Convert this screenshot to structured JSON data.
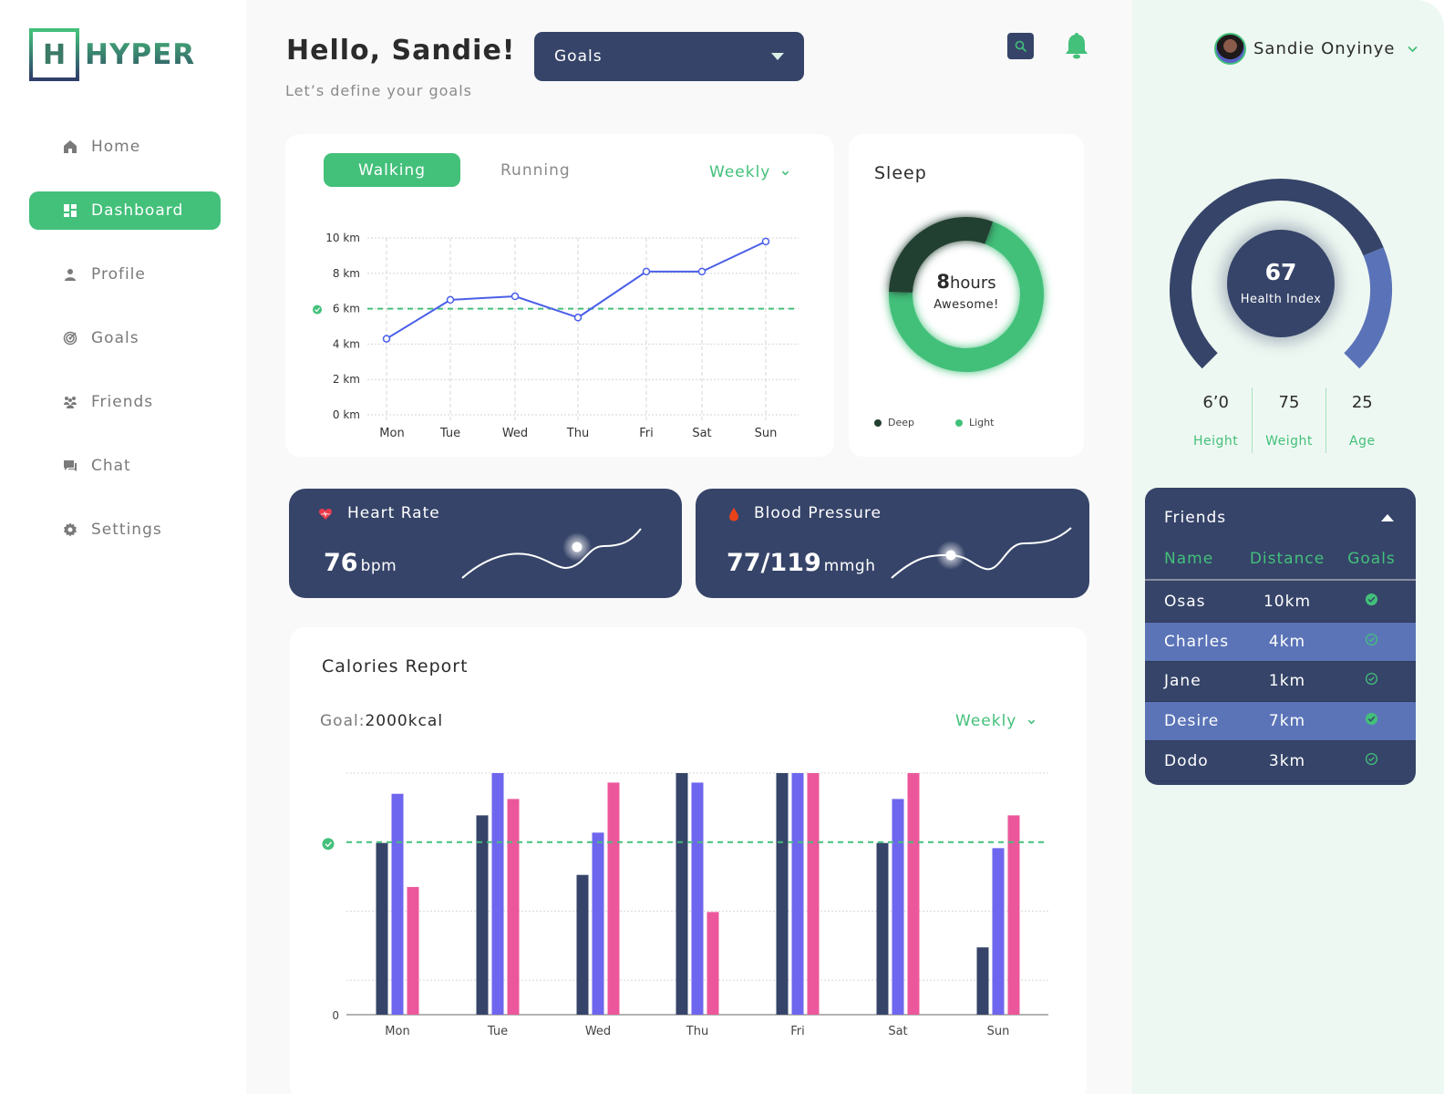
{
  "app": {
    "logo_letter": "H",
    "logo_text": "HYPER"
  },
  "sidebar": {
    "items": [
      {
        "label": "Home",
        "icon": "home-icon",
        "active": false
      },
      {
        "label": "Dashboard",
        "icon": "dashboard-icon",
        "active": true
      },
      {
        "label": "Profile",
        "icon": "user-icon",
        "active": false
      },
      {
        "label": "Goals",
        "icon": "target-icon",
        "active": false
      },
      {
        "label": "Friends",
        "icon": "group-icon",
        "active": false
      },
      {
        "label": "Chat",
        "icon": "chat-icon",
        "active": false
      },
      {
        "label": "Settings",
        "icon": "gear-icon",
        "active": false
      }
    ]
  },
  "header": {
    "greeting": "Hello, Sandie!",
    "subtitle": "Let’s define your goals",
    "select_value": "Goals",
    "search_icon": "search-icon",
    "bell_icon": "bell-icon"
  },
  "profile": {
    "name": "Sandie Onyinye"
  },
  "activity": {
    "tabs": [
      "Walking",
      "Running"
    ],
    "active_tab": "Walking",
    "period": "Weekly"
  },
  "sleep": {
    "title": "Sleep",
    "hours": "8",
    "hours_unit": "hours",
    "status": "Awesome!",
    "legend": [
      "Deep",
      "Light"
    ]
  },
  "heart_rate": {
    "title": "Heart Rate",
    "value": "76",
    "unit": "bpm"
  },
  "blood_pressure": {
    "title": "Blood Pressure",
    "value": "77/119",
    "unit": "mmgh"
  },
  "calories": {
    "title": "Calories Report",
    "goal_label": "Goal:",
    "goal_value": "2000kcal",
    "period": "Weekly"
  },
  "health": {
    "index": "67",
    "index_label": "Health Index",
    "stats": [
      {
        "value": "6’0",
        "label": "Height"
      },
      {
        "value": "75",
        "label": "Weight"
      },
      {
        "value": "25",
        "label": "Age"
      }
    ]
  },
  "friends": {
    "title": "Friends",
    "columns": [
      "Name",
      "Distance",
      "Goals"
    ],
    "rows": [
      {
        "name": "Osas",
        "distance": "10km",
        "goal_met": true
      },
      {
        "name": "Charles",
        "distance": "4km",
        "goal_met": false
      },
      {
        "name": "Jane",
        "distance": "1km",
        "goal_met": false
      },
      {
        "name": "Desire",
        "distance": "7km",
        "goal_met": true
      },
      {
        "name": "Dodo",
        "distance": "3km",
        "goal_met": false
      }
    ]
  },
  "colors": {
    "accent": "#43c07a",
    "navy": "#364469",
    "line": "#4a5ee8",
    "bar1": "#364469",
    "bar2": "#6e66ee",
    "bar3": "#ec579b",
    "deep_sleep": "#233f30",
    "gauge_light": "#5a73b8"
  },
  "chart_data": [
    {
      "type": "line",
      "title": "Walking",
      "categories": [
        "Mon",
        "Tue",
        "Wed",
        "Thu",
        "Fri",
        "Sat",
        "Sun"
      ],
      "values": [
        4.3,
        6.5,
        6.7,
        5.5,
        8.1,
        8.1,
        9.8
      ],
      "yticks": [
        "0 km",
        "2 km",
        "4 km",
        "6 km",
        "8 km",
        "10 km"
      ],
      "ylim": [
        0,
        10
      ],
      "goal": 6,
      "yunit": "km",
      "grid": true
    },
    {
      "type": "pie",
      "title": "Sleep",
      "labels": [
        "Deep",
        "Light"
      ],
      "values": [
        30,
        70
      ]
    },
    {
      "type": "gauge",
      "title": "Health Index",
      "value": 67,
      "segments": [
        {
          "name": "main",
          "fraction": 0.75
        },
        {
          "name": "secondary",
          "fraction": 0.25
        }
      ]
    },
    {
      "type": "bar",
      "title": "Calories Report",
      "categories": [
        "Mon",
        "Tue",
        "Wed",
        "Thu",
        "Fri",
        "Sat",
        "Sun"
      ],
      "series": [
        {
          "name": "series-1",
          "values": [
            1990,
            2310,
            1620,
            2800,
            2800,
            1990,
            780
          ]
        },
        {
          "name": "series-2",
          "values": [
            2560,
            2800,
            2110,
            2690,
            2800,
            2500,
            1930
          ]
        },
        {
          "name": "series-3",
          "values": [
            1480,
            2500,
            2690,
            1190,
            2800,
            2800,
            2310
          ]
        }
      ],
      "yticks": [
        "0"
      ],
      "ylim": [
        0,
        2800
      ],
      "goal": 2000,
      "grid": true
    }
  ]
}
